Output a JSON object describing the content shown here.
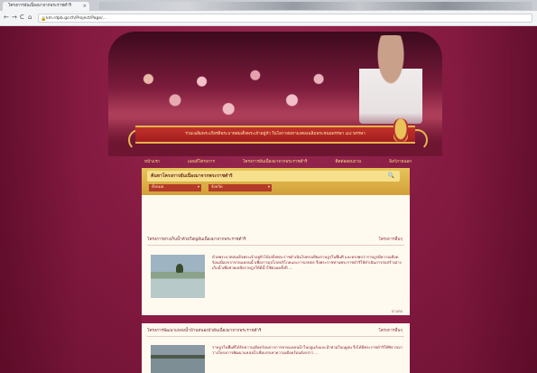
{
  "browser": {
    "tab_title": "โครงการอันเนื่องมาจากพระราชดำริ",
    "tab_close": "×",
    "back_icon": "arrow-left-icon",
    "back_glyph": "←",
    "forward_glyph": "→",
    "reload_glyph": "C",
    "home_glyph": "⌂",
    "lock_glyph": "🔒",
    "url": "km.rdpb.go.th/Project/Page/..."
  },
  "banner": {
    "ribbon_text": "ร่วมเฉลิมพระเกียรติพระบาทสมเด็จพระเจ้าอยู่หัว ในโอกาสมหามงคลเฉลิมพระชนมพรรษา ๘๔ พรรษา"
  },
  "nav": {
    "items": [
      {
        "label": "หน้าแรก"
      },
      {
        "label": "แผนที่โครงการ"
      },
      {
        "label": "โครงการอันเนื่องมาจากพระราชดำริ"
      },
      {
        "label": "ติดต่อสอบถาม"
      },
      {
        "label": "ลิงก์ภายนอก"
      }
    ]
  },
  "search": {
    "label": "ค้นหาโครงการอันเนื่องมาจากพระราชดำริ",
    "select_1": "ทั้งหมด",
    "select_2": "จังหวัด",
    "chevron": "▾",
    "icon_glyph": "🔍"
  },
  "sections": [
    {
      "title": "โครงการอ่างเก็บน้ำห้วยใหญ่อันเนื่องมาจากพระราชดำริ",
      "more": "โครงการอื่นๆ",
      "description": "ด้วยพระบาทสมเด็จพระเจ้าอยู่หัวได้เสด็จพระราชดำเนินไปทรงเยี่ยมราษฎรในพื้นที่ และทรงพบว่าราษฎรมีความเดือดร้อนเนื่องจากขาดแคลนน้ำเพื่อการอุปโภคบริโภคและการเกษตร จึงพระราชทานพระราชดำริให้ดำเนินการก่อสร้างอ่างเก็บน้ำเพื่อช่วยเหลือราษฎรให้มีน้ำใช้ตลอดทั้งปี ...",
      "read_more": "อ่านต่อ"
    },
    {
      "title": "โครงการพัฒนาแหล่งน้ำบ้านหนองบัวอันเนื่องมาจากพระราชดำริ",
      "more": "โครงการอื่นๆ",
      "description": "ราษฎรในพื้นที่ได้รับความเดือดร้อนจากการขาดแคลนน้ำในฤดูแล้งและน้ำท่วมในฤดูฝน จึงได้มีพระราชดำริให้พิจารณาวางโครงการพัฒนาแหล่งน้ำเพื่อบรรเทาความเดือดร้อนดังกล่าว ..."
    }
  ]
}
